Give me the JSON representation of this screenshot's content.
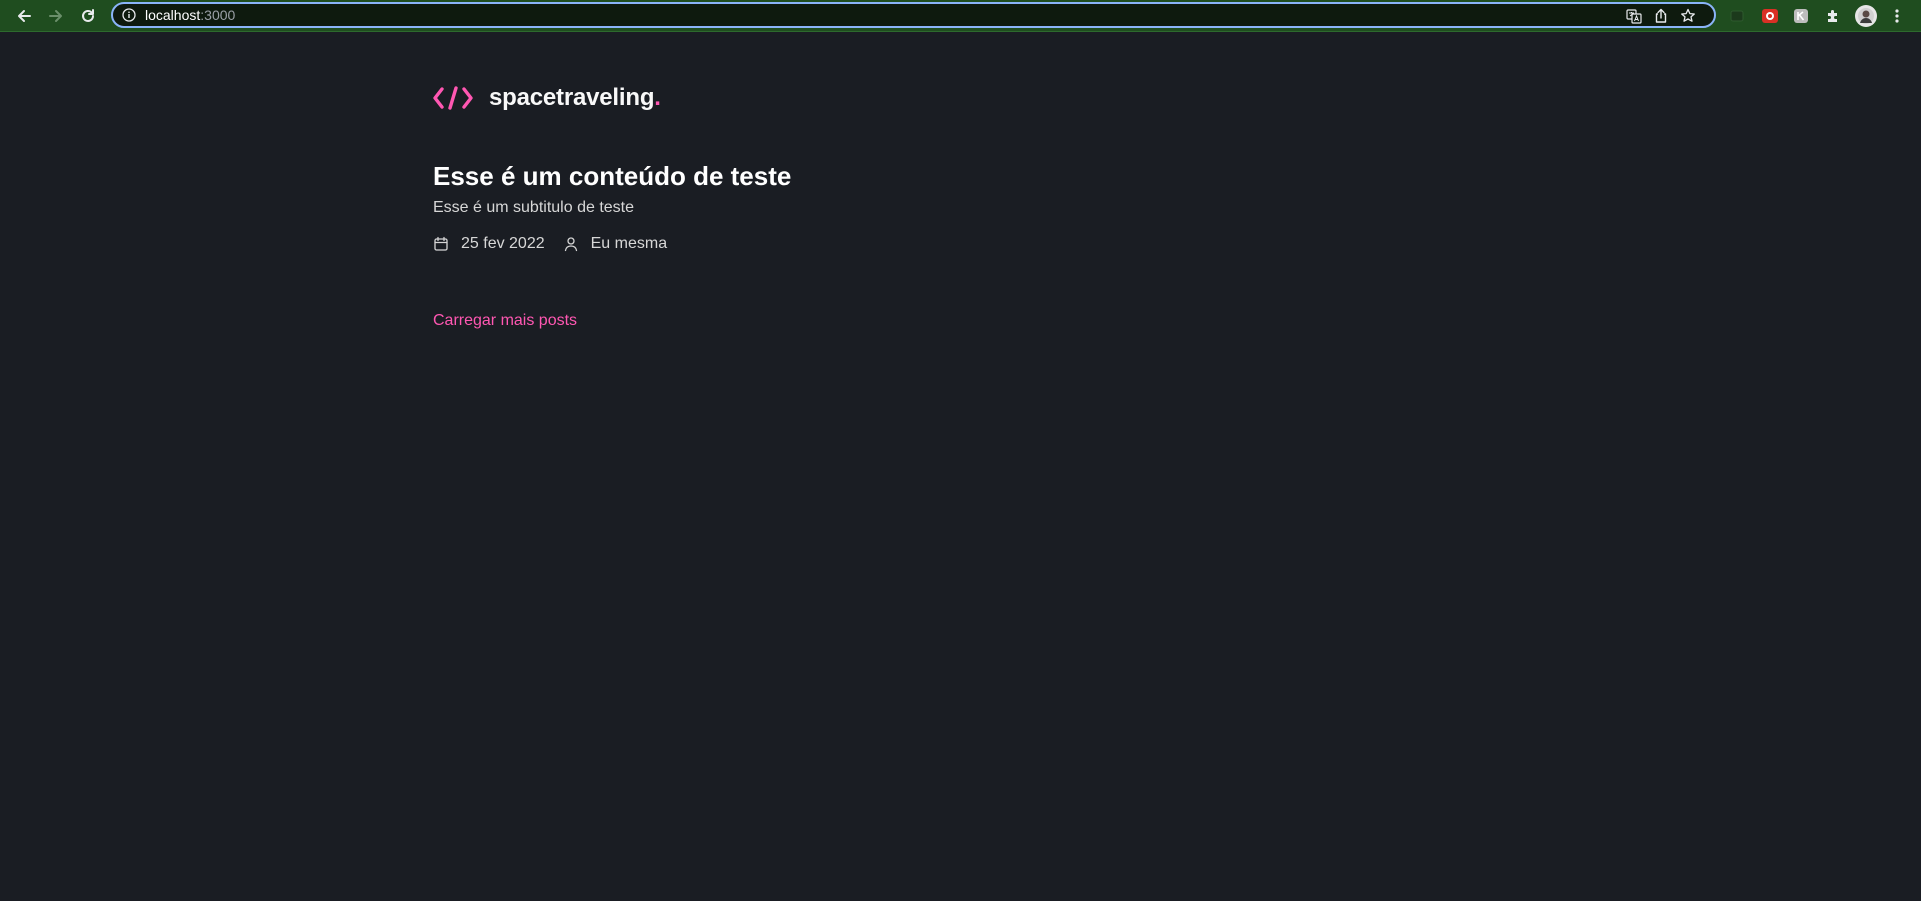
{
  "browser": {
    "url_host": "localhost",
    "url_port": ":3000",
    "icons": {
      "back": "arrow-left-icon",
      "forward": "arrow-right-icon",
      "reload": "reload-icon",
      "info": "info-icon",
      "translate": "translate-icon",
      "share": "share-icon",
      "bookmark": "star-icon",
      "extensions": "puzzle-icon",
      "profile": "avatar",
      "menu": "kebab-menu-icon"
    },
    "colors": {
      "toolbar": "#1f4d1f",
      "omnibox_border": "#8ab4f8"
    }
  },
  "header": {
    "logo_text": "spacetraveling",
    "logo_dot": ".",
    "logo_icon": "code-brackets-icon"
  },
  "posts": [
    {
      "title": "Esse é um conteúdo de teste",
      "subtitle": "Esse é um subtitulo de teste",
      "date": "25 fev 2022",
      "author": "Eu mesma",
      "date_icon": "calendar-icon",
      "author_icon": "user-icon"
    }
  ],
  "load_more_label": "Carregar mais posts",
  "colors": {
    "background": "#1a1d23",
    "accent": "#ff57b2",
    "heading": "#ffffff",
    "body_text": "#d7d7d7"
  }
}
